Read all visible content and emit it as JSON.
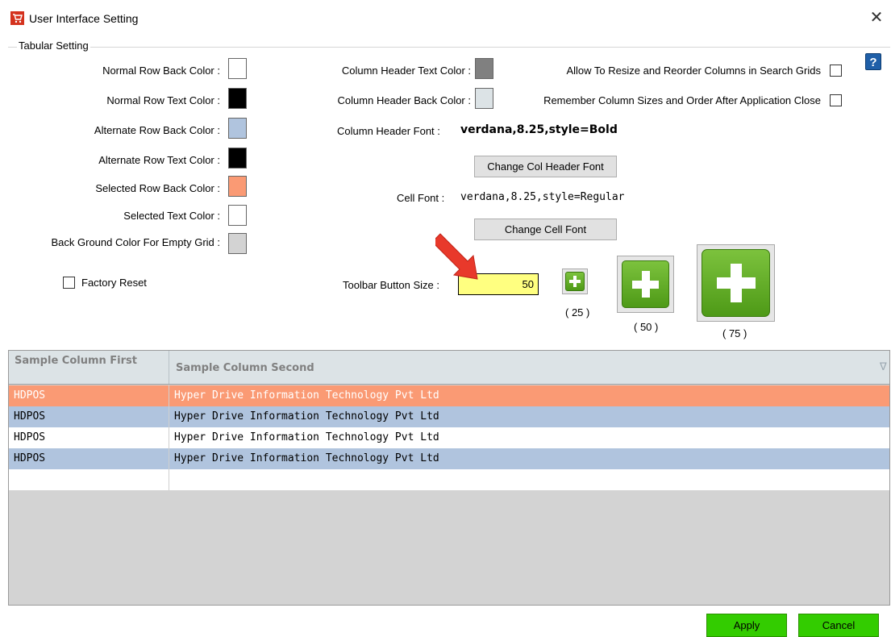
{
  "window": {
    "title": "User Interface Setting",
    "close_glyph": "✕",
    "help_glyph": "?"
  },
  "group": {
    "title": "Tabular Setting"
  },
  "colors": [
    {
      "label": "Normal Row Back Color :",
      "color": "#ffffff"
    },
    {
      "label": "Normal Row Text Color :",
      "color": "#000000"
    },
    {
      "label": "Alternate Row Back Color :",
      "color": "#b0c4de"
    },
    {
      "label": "Alternate Row Text Color :",
      "color": "#000000"
    },
    {
      "label": "Selected Row Back Color :",
      "color": "#fa9a74"
    },
    {
      "label": "Selected Text Color :",
      "color": "#ffffff"
    },
    {
      "label": "Back Ground Color For Empty Grid :",
      "color": "#d3d3d3"
    }
  ],
  "factory_reset": {
    "label": "Factory Reset",
    "checked": false
  },
  "column_header": {
    "text_color_label": "Column Header Text Color :",
    "text_color": "#808080",
    "back_color_label": "Column Header Back Color :",
    "back_color": "#dce3e6",
    "font_label": "Column Header Font :",
    "font_value": "verdana,8.25,style=Bold",
    "change_button": "Change  Col Header Font"
  },
  "cell_font": {
    "label": "Cell Font :",
    "value": "verdana,8.25,style=Regular",
    "change_button": "Change Cell Font"
  },
  "toolbar": {
    "label": "Toolbar Button Size :",
    "value": "50",
    "sizes": [
      "( 25 )",
      "( 50 )",
      "( 75 )"
    ]
  },
  "options": [
    {
      "label": "Allow To Resize and Reorder Columns in Search Grids",
      "checked": false
    },
    {
      "label": "Remember Column Sizes and Order After Application Close",
      "checked": false
    }
  ],
  "grid": {
    "columns": [
      "Sample Column First",
      "Sample Column Second"
    ],
    "filter_glyph": "∇",
    "rows": [
      {
        "first": "HDPOS",
        "second": "Hyper Drive Information Technology Pvt Ltd",
        "style": "selected"
      },
      {
        "first": "HDPOS",
        "second": "Hyper Drive Information Technology Pvt Ltd",
        "style": "alternate"
      },
      {
        "first": "HDPOS",
        "second": "Hyper Drive Information Technology Pvt Ltd",
        "style": "normal"
      },
      {
        "first": "HDPOS",
        "second": "Hyper Drive Information Technology Pvt Ltd",
        "style": "alternate"
      }
    ]
  },
  "buttons": {
    "apply": "Apply",
    "cancel": "Cancel"
  }
}
